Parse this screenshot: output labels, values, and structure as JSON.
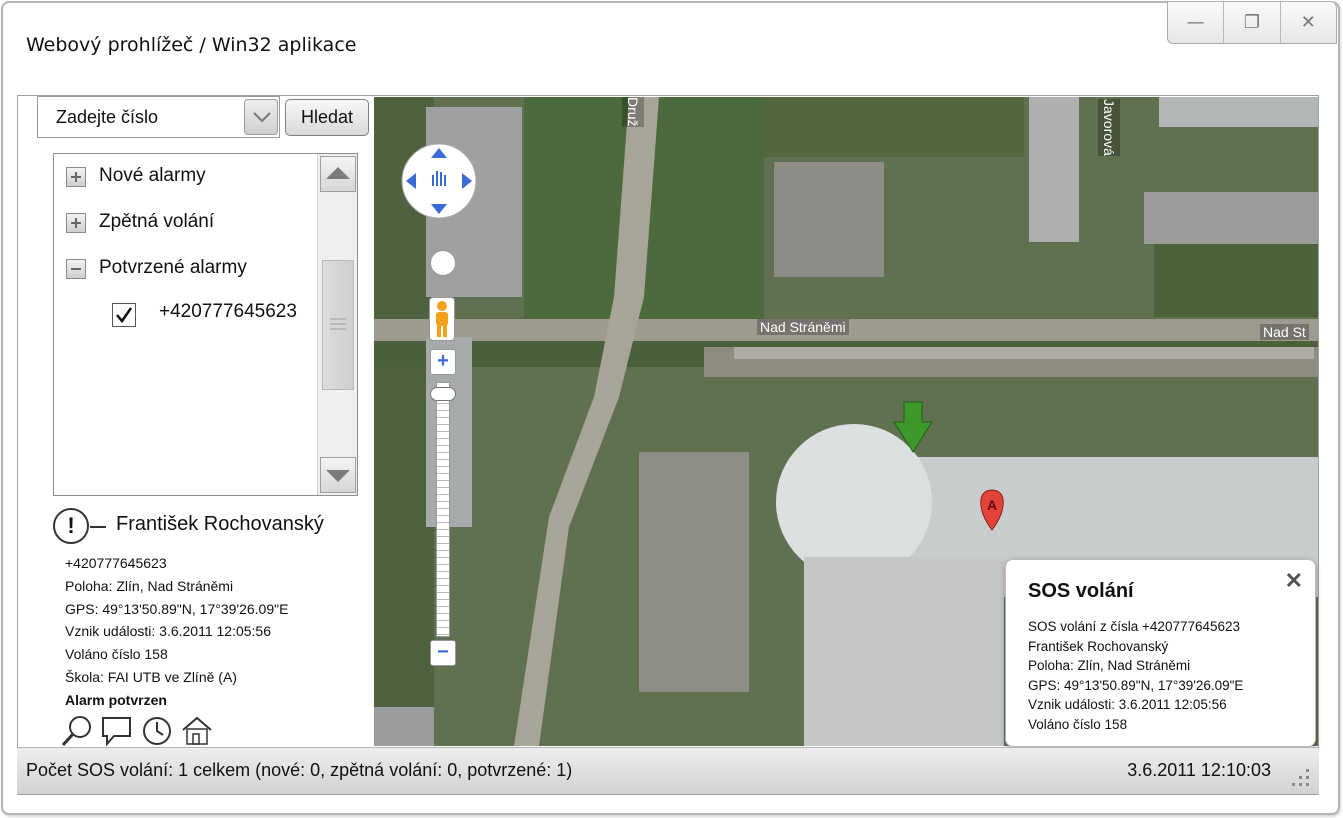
{
  "window": {
    "title": "Webový prohlížeč / Win32 aplikace",
    "minimize": "—",
    "restore": "❐",
    "close": "✕"
  },
  "search": {
    "value": "Zadejte číslo",
    "button": "Hledat"
  },
  "tree": {
    "items": [
      {
        "label": "Nové alarmy",
        "state": "collapsed"
      },
      {
        "label": "Zpětná volání",
        "state": "collapsed"
      },
      {
        "label": "Potvrzené alarmy",
        "state": "expanded"
      }
    ],
    "child": {
      "label": "+420777645623",
      "checked": true
    }
  },
  "alarm": {
    "icon": "!",
    "name": "František Rochovanský",
    "lines": [
      "+420777645623",
      "Poloha: Zlín, Nad Stráněmi",
      "GPS: 49°13'50.89\"N, 17°39'26.09\"E",
      "Vznik události: 3.6.2011 12:05:56",
      "Voláno číslo 158",
      "Škola: FAI UTB ve Zlíně (A)"
    ],
    "status": "Alarm potvrzen",
    "actions": [
      "search-icon",
      "message-icon",
      "clock-icon",
      "home-icon"
    ]
  },
  "map": {
    "streets": [
      "Druž",
      "Javorová",
      "Nad Stráněmi",
      "Nad St"
    ],
    "zoom_in": "+",
    "zoom_out": "−",
    "marker_label": "A"
  },
  "infowindow": {
    "title": "SOS volání",
    "close": "✕",
    "lines": [
      "SOS volání z čísla +420777645623",
      "František Rochovanský",
      "Poloha: Zlín, Nad Stráněmi",
      "GPS: 49°13'50.89\"N, 17°39'26.09\"E",
      "Vznik události: 3.6.2011 12:05:56",
      "Voláno číslo 158"
    ]
  },
  "statusbar": {
    "summary": "Počet SOS volání: 1 celkem (nové: 0, zpětná volání: 0, potvrzené: 1)",
    "datetime": "3.6.2011 12:10:03"
  }
}
